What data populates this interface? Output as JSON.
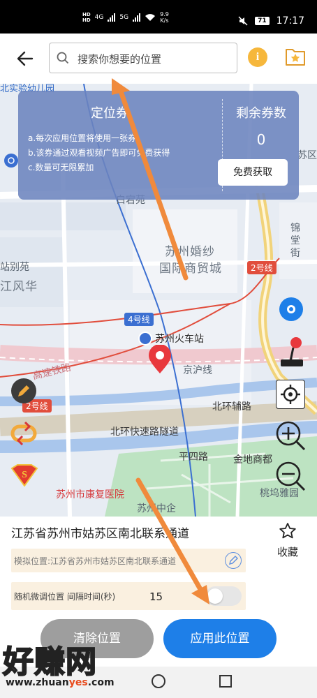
{
  "status_bar": {
    "network_hd_1": "HD",
    "network_hd_2": "HD",
    "sim1": "4G",
    "sim2": "5G",
    "speed_value": "9.9",
    "speed_unit": "K/s",
    "battery": "71",
    "time": "17:17"
  },
  "top_bar": {
    "search_placeholder": "搜索你想要的位置",
    "info_label": "i"
  },
  "map": {
    "labels": {
      "kindergarten": "北实验幼儿园",
      "baicaoyuan": "白宕苑",
      "wedding": "苏州婚纱",
      "trade_city": "国际商贸城",
      "zhanbie": "站别苑",
      "jiangfenghua": "江风华",
      "jintang": "锦",
      "tang": "堂",
      "jie": "街",
      "su": "苏区",
      "highspeed": "高速铁路",
      "jinghu": "京沪线",
      "beihuan_fulu": "北环辅路",
      "beihuan_tunnel": "北环快速路隧道",
      "pingsi": "平四路",
      "jindi": "金地商都",
      "taowu": "桃坞雅园",
      "hospital": "苏州市康复医院",
      "suzhouzhong": "苏州中企"
    },
    "lines": {
      "line2_a": "2号线",
      "line2_b": "2号线",
      "line4": "4号线"
    },
    "station": "苏州火车站"
  },
  "coupon": {
    "title": "定位券",
    "rule_a": "a.每次应用位置将使用一张券",
    "rule_b": "b.该券通过观看视频广告即可免费获得",
    "rule_c": "c.数量可无限累加",
    "remain_label": "剩余券数",
    "remain_count": "0",
    "get_button": "免费获取"
  },
  "panel": {
    "address": "江苏省苏州市姑苏区南北联系通道",
    "collect_label": "收藏",
    "sim_location": "模拟位置:江苏省苏州市姑苏区南北联系通道",
    "random_label": "随机微调位置 间隔时间(秒)",
    "random_interval": "15",
    "random_enabled": false,
    "clear_button": "清除位置",
    "apply_button": "应用此位置"
  },
  "watermark": {
    "big": "好赚网",
    "small_a": "www.zhuan",
    "small_b": "yes",
    "small_c": ".com"
  },
  "colors": {
    "apply": "#1e7fe8",
    "clear": "#9e9e9e",
    "coupon": "#6c84be",
    "pin": "#e8383d",
    "info": "#f6b73c"
  },
  "icons": [
    "back-arrow-icon",
    "search-icon",
    "info-icon",
    "favorite-folder-icon",
    "location-pin-icon",
    "joystick-icon",
    "crosshair-icon",
    "zoom-in-icon",
    "zoom-out-icon",
    "star-icon",
    "edit-pencil-icon"
  ]
}
